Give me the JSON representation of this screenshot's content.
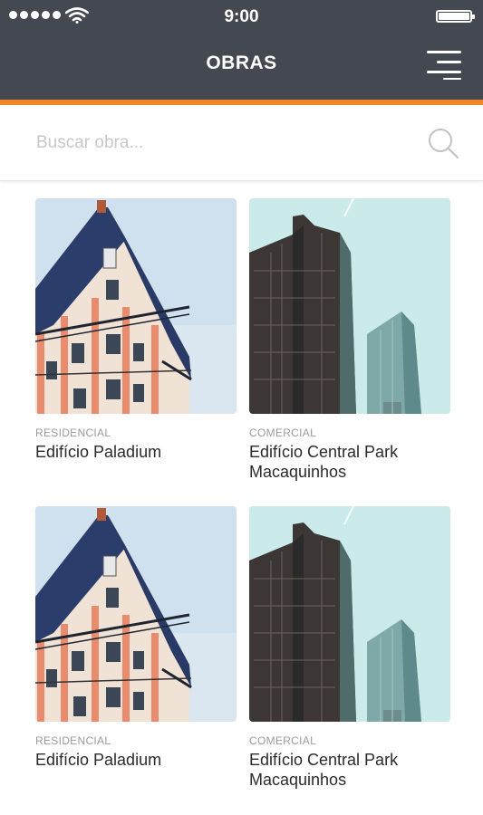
{
  "status_bar": {
    "time": "9:00"
  },
  "header": {
    "title": "OBRAS",
    "menu_icon": "hamburger-menu-icon",
    "accent_color": "#f0862a",
    "background_color": "#444851"
  },
  "search": {
    "placeholder": "Buscar obra...",
    "value": "",
    "icon": "search-icon"
  },
  "projects": [
    {
      "category": "RESIDENCIAL",
      "name": "Edifício Paladium",
      "image": "classic-apartment-building"
    },
    {
      "category": "COMERCIAL",
      "name": "Edifício Central Park Macaquinhos",
      "image": "glass-skyscrapers"
    },
    {
      "category": "RESIDENCIAL",
      "name": "Edifício Paladium",
      "image": "classic-apartment-building"
    },
    {
      "category": "COMERCIAL",
      "name": "Edifício Central Park Macaquinhos",
      "image": "glass-skyscrapers"
    }
  ]
}
